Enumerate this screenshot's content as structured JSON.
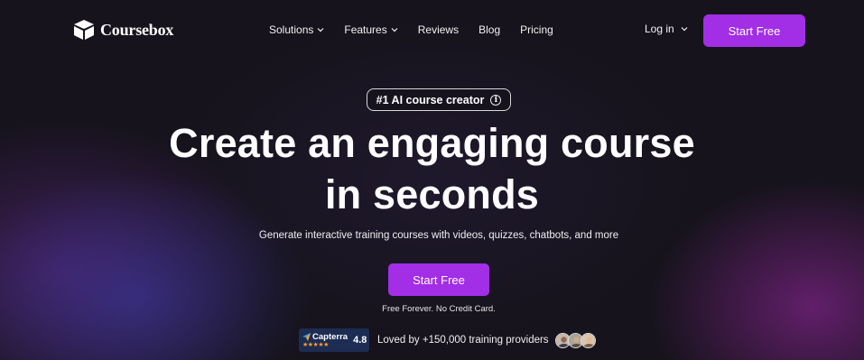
{
  "brand": {
    "name": "Coursebox",
    "logo_icon": "box-icon"
  },
  "nav": {
    "items": [
      {
        "label": "Solutions",
        "has_dropdown": true
      },
      {
        "label": "Features",
        "has_dropdown": true
      },
      {
        "label": "Reviews",
        "has_dropdown": false
      },
      {
        "label": "Blog",
        "has_dropdown": false
      },
      {
        "label": "Pricing",
        "has_dropdown": false
      }
    ],
    "login_label": "Log in",
    "cta_label": "Start Free"
  },
  "hero": {
    "badge": "#1 AI course creator",
    "headline_line1": "Create an engaging course",
    "headline_line2": "in seconds",
    "subheadline": "Generate interactive training courses with videos, quizzes, chatbots, and more",
    "cta_label": "Start Free",
    "note": "Free Forever. No Credit Card."
  },
  "social_proof": {
    "capterra_label": "Capterra",
    "capterra_stars": "★★★★★",
    "capterra_score": "4.8",
    "text": "Loved by +150,000 training providers"
  },
  "colors": {
    "accent": "#a22ee6",
    "background": "#16131c",
    "capterra_bg": "#1d2c52",
    "star": "#ff9d28"
  }
}
